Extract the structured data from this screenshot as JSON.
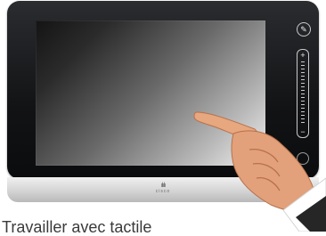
{
  "device": {
    "brand": "cisco",
    "controls": {
      "mute_icon": "microphone-mute-icon",
      "volume_up": "+",
      "volume_down": "−",
      "power_icon": "power-icon"
    }
  },
  "caption": "Travailler avec tactile"
}
